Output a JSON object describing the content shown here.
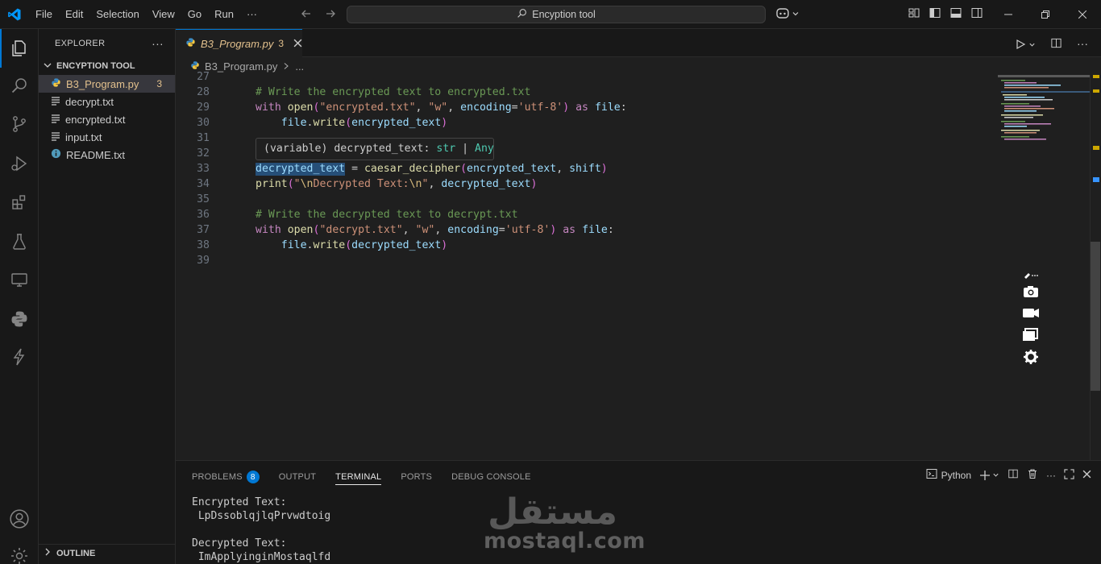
{
  "titlebar": {
    "menu": [
      "File",
      "Edit",
      "Selection",
      "View",
      "Go",
      "Run",
      "···"
    ],
    "search_text": "Encyption tool"
  },
  "sidebar": {
    "header": "EXPLORER",
    "more": "···",
    "folder": "ENCYPTION TOOL",
    "files": [
      {
        "name": "B3_Program.py",
        "badge": "3",
        "icon": "python-icon",
        "active": true
      },
      {
        "name": "decrypt.txt",
        "icon": "text-file-icon"
      },
      {
        "name": "encrypted.txt",
        "icon": "text-file-icon"
      },
      {
        "name": "input.txt",
        "icon": "text-file-icon"
      },
      {
        "name": "README.txt",
        "icon": "info-icon"
      }
    ],
    "outline": "OUTLINE"
  },
  "editor": {
    "tab": {
      "name": "B3_Program.py",
      "badge": "3"
    },
    "breadcrumb": {
      "file": "B3_Program.py",
      "more": "..."
    },
    "line_numbers": [
      "27",
      "28",
      "29",
      "30",
      "31",
      "32",
      "33",
      "34",
      "35",
      "36",
      "37",
      "38",
      "39"
    ],
    "hover": {
      "prefix": "(variable) decrypted_text: ",
      "type1": "str",
      "sep": " | ",
      "type2": "Any"
    }
  },
  "panel": {
    "tabs": [
      "PROBLEMS",
      "OUTPUT",
      "TERMINAL",
      "PORTS",
      "DEBUG CONSOLE"
    ],
    "problems_count": "8",
    "terminal_profile": "Python",
    "terminal_lines": [
      "Encrypted Text:",
      " LpDssoblqjlqPrvwdtoig",
      "",
      "Decrypted Text:",
      " ImApplyinginMostaqlfd"
    ]
  },
  "watermark": {
    "arabic": "مستقل",
    "latin": "mostaql.com"
  },
  "colors": {
    "accent": "#0078d4",
    "modified": "#e2c08d",
    "background": "#1f1f1f",
    "sidebar": "#181818"
  }
}
